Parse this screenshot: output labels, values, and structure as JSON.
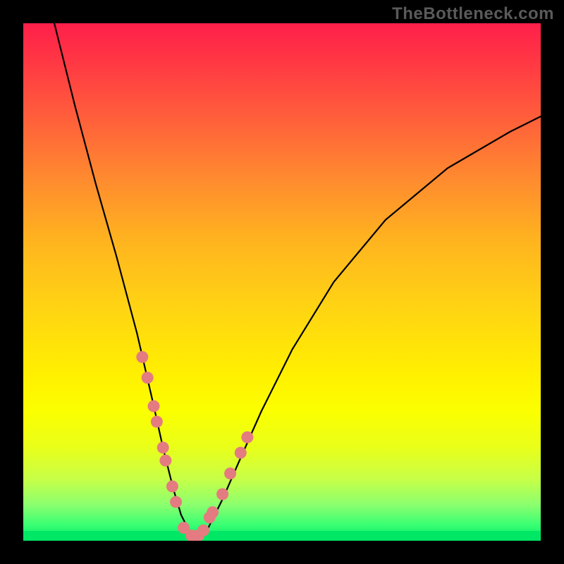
{
  "watermark": "TheBottleneck.com",
  "colors": {
    "background": "#000000",
    "gradient_top": "#ff1f4a",
    "gradient_bottom": "#00e765",
    "curve_stroke": "#000000",
    "marker_fill": "#e47b80"
  },
  "chart_data": {
    "type": "line",
    "title": "",
    "xlabel": "",
    "ylabel": "",
    "xlim": [
      0,
      100
    ],
    "ylim": [
      0,
      100
    ],
    "series": [
      {
        "name": "curve",
        "x": [
          6,
          10,
          14,
          18,
          22,
          25,
          27,
          29,
          30.5,
          32,
          33.5,
          35.5,
          38.5,
          42,
          46,
          52,
          60,
          70,
          82,
          94,
          100
        ],
        "y": [
          100,
          84,
          69,
          55,
          40,
          27,
          18,
          10,
          5,
          2,
          0.5,
          2,
          8,
          16,
          25,
          37,
          50,
          62,
          72,
          79,
          82
        ]
      }
    ],
    "markers": {
      "name": "dots",
      "x": [
        23.0,
        24.0,
        25.2,
        25.8,
        27.0,
        27.5,
        28.8,
        29.5,
        31.0,
        32.5,
        33.8,
        34.8,
        36.0,
        36.6,
        38.5,
        40.0,
        42.0,
        43.3
      ],
      "y": [
        35.5,
        31.5,
        26.0,
        23.0,
        18.0,
        15.5,
        10.5,
        7.5,
        2.5,
        1.0,
        1.0,
        2.0,
        4.5,
        5.5,
        9.0,
        13.0,
        17.0,
        20.0
      ]
    }
  }
}
